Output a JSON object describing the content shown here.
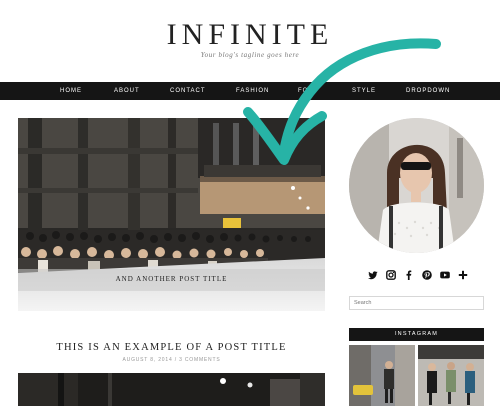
{
  "header": {
    "title": "INFINITE",
    "tagline": "Your blog's tagline goes here"
  },
  "nav": {
    "items": [
      "HOME",
      "ABOUT",
      "CONTACT",
      "FASHION",
      "FO",
      "STYLE",
      "DROPDOWN"
    ]
  },
  "featured": {
    "title": "AND ANOTHER POST TITLE"
  },
  "post": {
    "title": "THIS IS AN EXAMPLE OF A POST TITLE",
    "meta": "AUGUST 8, 2014 / 3 COMMENTS"
  },
  "sidebar": {
    "social_icons": [
      "twitter-icon",
      "instagram-icon",
      "facebook-icon",
      "pinterest-icon",
      "youtube-icon",
      "plus-icon"
    ],
    "search_placeholder": "Search",
    "instagram_heading": "INSTAGRAM"
  },
  "colors": {
    "nav_bg": "#151515",
    "arrow": "#27b3a6",
    "text": "#222222"
  }
}
